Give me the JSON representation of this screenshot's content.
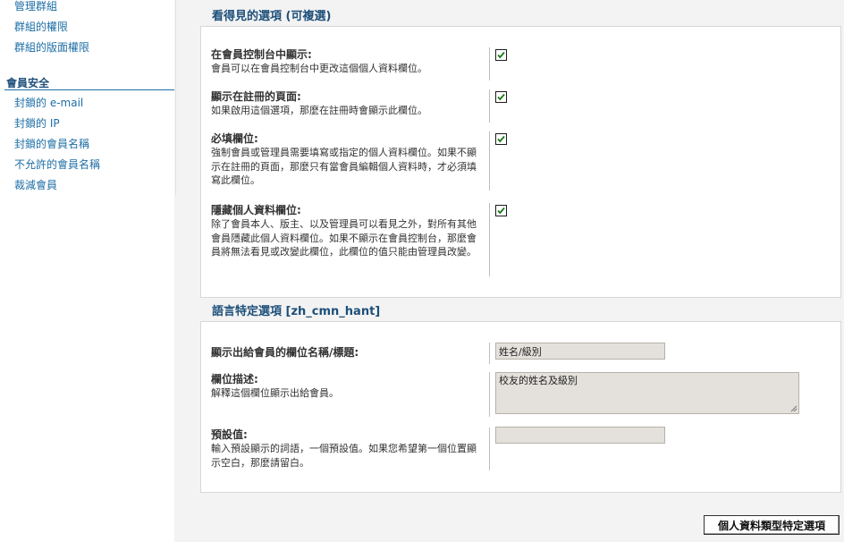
{
  "sidebar": {
    "group_items": [
      {
        "label": "管理群組"
      },
      {
        "label": "群組的權限"
      },
      {
        "label": "群組的版面權限"
      }
    ],
    "security_heading": "會員安全",
    "security_items": [
      {
        "label": "封鎖的 e-mail"
      },
      {
        "label": "封鎖的 IP"
      },
      {
        "label": "封鎖的會員名稱"
      },
      {
        "label": "不允許的會員名稱"
      },
      {
        "label": "裁減會員"
      }
    ]
  },
  "visibility": {
    "title": "看得見的選項 (可複選)",
    "options": [
      {
        "title": "在會員控制台中顯示:",
        "desc": "會員可以在會員控制台中更改這個個人資料欄位。",
        "checked": true
      },
      {
        "title": "顯示在註冊的頁面:",
        "desc": "如果啟用這個選項，那麼在註冊時會顯示此欄位。",
        "checked": true
      },
      {
        "title": "必填欄位:",
        "desc": "強制會員或管理員需要填寫或指定的個人資料欄位。如果不顯示在註冊的頁面，那麼只有當會員編輯個人資料時，才必須填寫此欄位。",
        "checked": true
      },
      {
        "title": "隱藏個人資料欄位:",
        "desc": "除了會員本人、版主、以及管理員可以看見之外，對所有其他會員隱藏此個人資料欄位。如果不顯示在會員控制台，那麼會員將無法看見或改變此欄位，此欄位的值只能由管理員改變。",
        "checked": true
      }
    ]
  },
  "language": {
    "title": "語言特定選項 [zh_cmn_hant]",
    "field_name": {
      "title": "顯示出給會員的欄位名稱/標題:",
      "value": "姓名/級別"
    },
    "field_desc": {
      "title": "欄位描述:",
      "desc": "解釋這個欄位顯示出給會員。",
      "value": "校友的姓名及級別"
    },
    "default_value": {
      "title": "預設值:",
      "desc": "輸入預設顯示的詞語，一個預設值。如果您希望第一個位置顯示空白，那麼請留白。",
      "value": ""
    }
  },
  "submit_label": "個人資料類型特定選項",
  "colors": {
    "link": "#1d6ea5",
    "heading": "#1d4f7a",
    "checkmark": "#1a7a1a",
    "input_bg": "#e4e1dc"
  }
}
